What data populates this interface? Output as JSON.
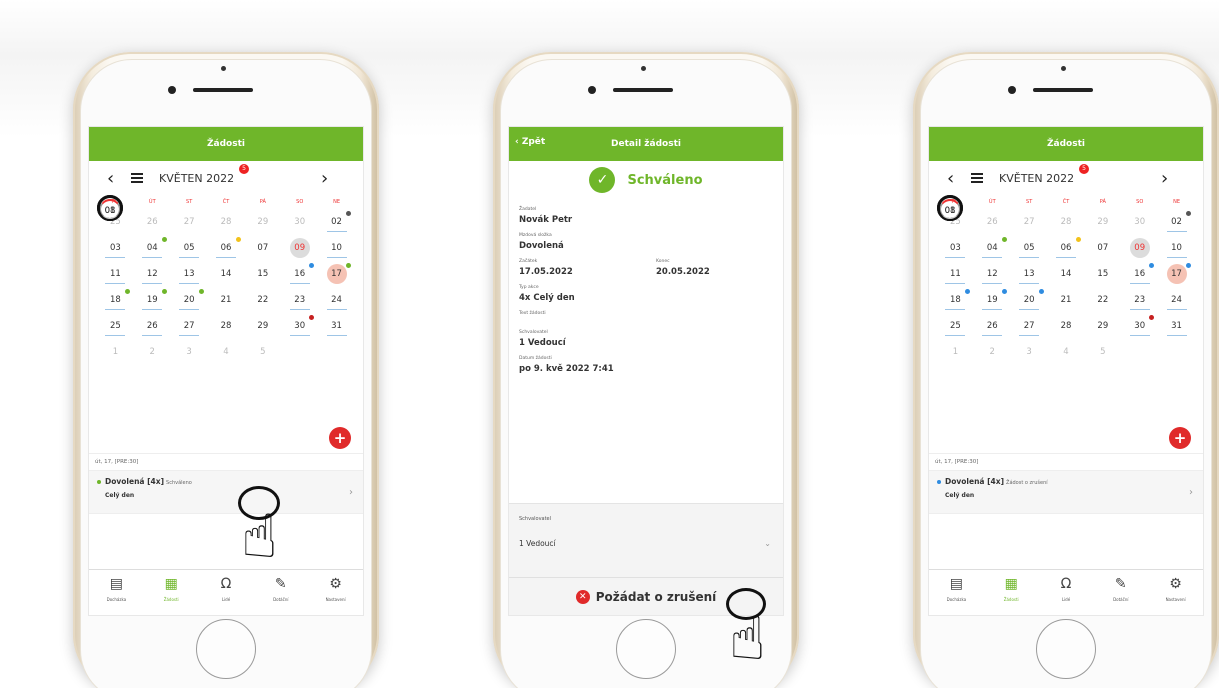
{
  "colors": {
    "accent": "#6fb62a",
    "danger": "#e02a2a",
    "selected_day": "#f5c2b4"
  },
  "screen1": {
    "title": "Žádosti",
    "month": "KVĚTEN 2022",
    "notif_count": "5",
    "weekdays": [
      "PO",
      "ÚT",
      "ST",
      "ČT",
      "PÁ",
      "SO",
      "NE"
    ],
    "days": [
      "25",
      "26",
      "27",
      "28",
      "29",
      "30",
      "01",
      "02",
      "03",
      "04",
      "05",
      "06",
      "07",
      "08",
      "09",
      "10",
      "11",
      "12",
      "13",
      "14",
      "15",
      "16",
      "17",
      "18",
      "19",
      "20",
      "21",
      "22",
      "23",
      "24",
      "25",
      "26",
      "27",
      "28",
      "29",
      "30",
      "31",
      "1",
      "2",
      "3",
      "4",
      "5"
    ],
    "date_label": "út, 17, [PRE:30]",
    "item_title": "Dovolená [4x]",
    "item_status": "Schváleno",
    "item_sub": "Celý den",
    "tabs": [
      "Docházka",
      "Žádosti",
      "Lidé",
      "Dotáční",
      "Nastavení"
    ]
  },
  "screen2": {
    "title": "Detail žádosti",
    "back": "Zpět",
    "status": "Schváleno",
    "fields": {
      "zadatel_label": "Žadatel",
      "zadatel": "Novák Petr",
      "slozka_label": "Mzdová složka",
      "slozka": "Dovolená",
      "zacatek_label": "Začátek",
      "zacatek": "17.05.2022",
      "konec_label": "Konec",
      "konec": "20.05.2022",
      "typ_label": "Typ akce",
      "typ": "4x Celý den",
      "text_label": "Text žádosti",
      "schvalovatel_label": "Schvalovatel",
      "schvalovatel": "1 Vedoucí",
      "datum_label": "Datum žádosti",
      "datum": "po 9. kvě 2022 7:41"
    },
    "select_label": "Schvalovatel",
    "select_value": "1 Vedoucí",
    "cancel_label": "Požádat o zrušení"
  },
  "screen3": {
    "title": "Žádosti",
    "month": "KVĚTEN 2022",
    "notif_count": "5",
    "date_label": "út, 17, [PRE:30]",
    "item_title": "Dovolená [4x]",
    "item_status": "Žádost o zrušení",
    "item_sub": "Celý den",
    "tabs": [
      "Docházka",
      "Žádosti",
      "Lidé",
      "Dotáční",
      "Nastavení"
    ]
  },
  "icons": [
    "calendar-list-icon",
    "plus-icon",
    "check-icon",
    "cancel-icon",
    "pointing-hand-icon",
    "clipboard-icon",
    "calendar-icon",
    "people-icon",
    "pencil-icon",
    "gear-icon"
  ]
}
